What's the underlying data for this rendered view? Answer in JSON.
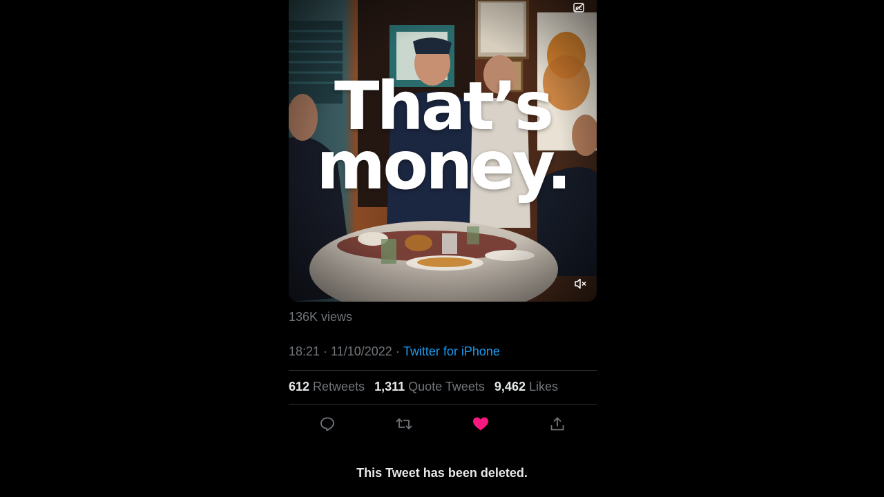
{
  "video": {
    "caption_line1": "That’s",
    "caption_line2": "money.",
    "cc_icon": "closed-captions-icon",
    "mute_icon": "speaker-muted-icon"
  },
  "tweet": {
    "views": "136K views",
    "time": "18:21",
    "date": "11/10/2022",
    "source": "Twitter for iPhone",
    "retweets_count": "612",
    "retweets_label": "Retweets",
    "quotes_count": "1,311",
    "quotes_label": "Quote Tweets",
    "likes_count": "9,462",
    "likes_label": "Likes"
  },
  "actions": {
    "reply_icon": "reply-icon",
    "retweet_icon": "retweet-icon",
    "like_icon": "heart-filled-icon",
    "share_icon": "share-icon"
  },
  "colors": {
    "background": "#000000",
    "secondary_text": "#71767b",
    "link": "#1d9bf0",
    "like": "#f91880"
  },
  "deleted_notice": "This Tweet has been deleted."
}
